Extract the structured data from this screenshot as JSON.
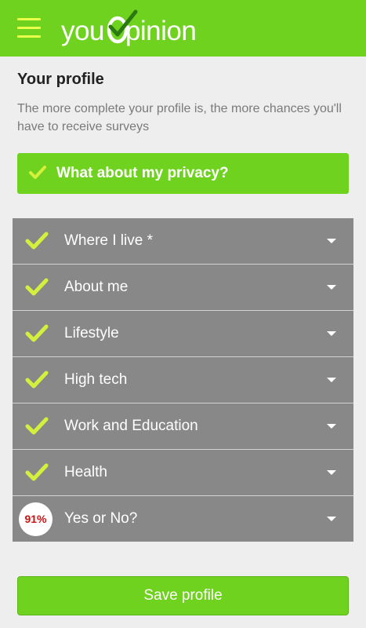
{
  "header": {
    "brand_prefix": "you",
    "brand_suffix": "pinion",
    "menu_icon": "hamburger-menu-icon"
  },
  "page": {
    "title": "Your profile",
    "subtitle": "The more complete your profile is, the more chances you'll have to receive surveys"
  },
  "privacy": {
    "label": "What about my privacy?",
    "icon": "check-icon"
  },
  "sections": [
    {
      "label": "Where I live *",
      "status": "complete"
    },
    {
      "label": "About me",
      "status": "complete"
    },
    {
      "label": "Lifestyle",
      "status": "complete"
    },
    {
      "label": "High tech",
      "status": "complete"
    },
    {
      "label": "Work and Education",
      "status": "complete"
    },
    {
      "label": "Health",
      "status": "complete"
    },
    {
      "label": "Yes or No?",
      "status": "progress",
      "progress_text": "91%",
      "progress": 0.91
    }
  ],
  "actions": {
    "save_label": "Save profile"
  },
  "colors": {
    "brand_green": "#6fd21f",
    "check_yellow": "#d4f03c",
    "section_gray": "#888888",
    "progress_red": "#cc1111"
  }
}
